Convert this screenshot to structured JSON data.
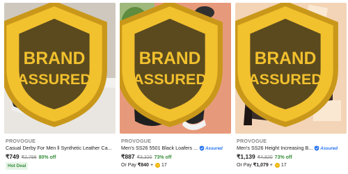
{
  "products": [
    {
      "brand": "PROVOGUE",
      "title": "Casual Derby For Men ll Synthetic Leather Ca...",
      "price": "₹749",
      "mrp": "₹2,799",
      "discount": "80% off",
      "badge": "Hot Deal",
      "assured": false,
      "badge_text": "BRAND ASSURED"
    },
    {
      "brand": "PROVOGUE",
      "title": "Men's SS26 5501 Black Loafers ...",
      "assured_label": "Assured",
      "price": "₹887",
      "mrp": "₹3,320",
      "discount": "73% off",
      "pay_prefix": "Or Pay",
      "pay_amount": "₹840",
      "pay_plus": "+",
      "coins": "17",
      "assured": true,
      "badge_text": "BRAND ASSURED"
    },
    {
      "brand": "PROVOGUE",
      "title": "Men's SS26 Height Increasing B...",
      "assured_label": "Assured",
      "price": "₹1,139",
      "mrp": "₹4,820",
      "discount": "73% off",
      "pay_prefix": "Or Pay",
      "pay_amount": "₹1,079",
      "pay_plus": "+",
      "coins": "17",
      "assured": true,
      "badge_text": "BRAND ASSURED"
    }
  ],
  "colors": {
    "price_green": "#388e3c",
    "assured_blue": "#2874f0",
    "muted_grey": "#878787"
  },
  "icons": {
    "wishlist": "heart-icon",
    "assured": "flipkart-assured-icon",
    "coin": "supercoin-icon",
    "brand_badge": "brand-assured-badge-icon"
  }
}
